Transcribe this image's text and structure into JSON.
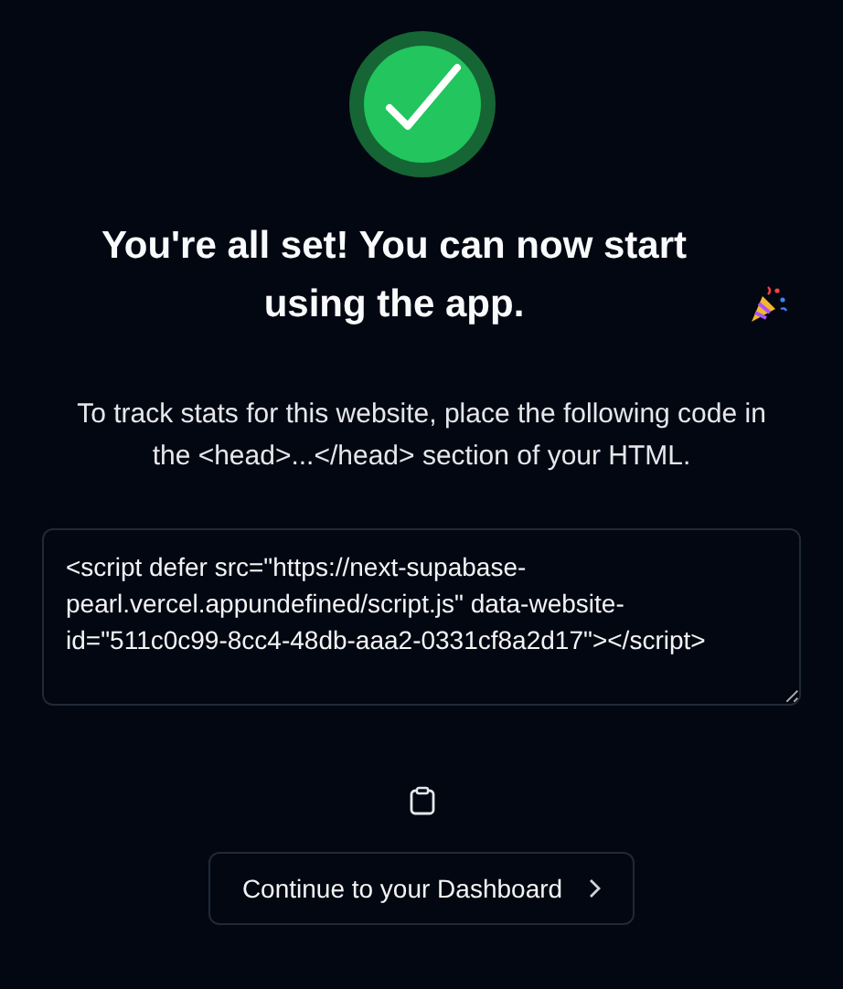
{
  "heading": "You're all set! You can now start using the app.",
  "instructions": "To track stats for this website, place the following code in the <head>...</head> section of your HTML.",
  "code": "<script defer src=\"https://next-supabase-pearl.vercel.appundefined/script.js\" data-website-id=\"511c0c99-8cc4-48db-aaa2-0331cf8a2d17\"></script>",
  "continue_button": {
    "label": "Continue to your Dashboard"
  }
}
